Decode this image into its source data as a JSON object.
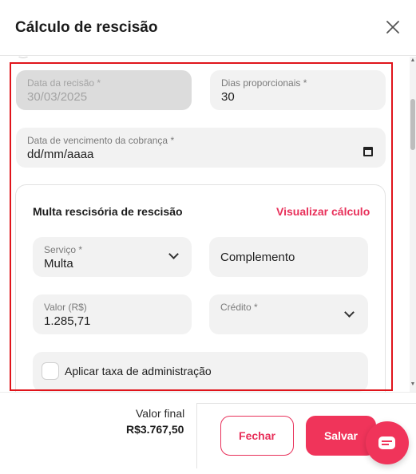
{
  "dialog": {
    "title": "Cálculo de rescisão",
    "close_icon": "close-icon"
  },
  "form": {
    "data_rescisao": {
      "label": "Data da recisão *",
      "value": "30/03/2025",
      "disabled": true
    },
    "dias_proporcionais": {
      "label": "Dias proporcionais *",
      "value": "30"
    },
    "data_vencimento": {
      "label": "Data de vencimento da cobrança *",
      "value": "dd/mm/aaaa",
      "icon": "calendar-icon"
    }
  },
  "multa_card": {
    "title": "Multa rescisória de rescisão",
    "link": "Visualizar cálculo",
    "servico": {
      "label": "Serviço *",
      "value": "Multa"
    },
    "complemento": {
      "placeholder": "Complemento"
    },
    "valor": {
      "label": "Valor (R$)",
      "value": "1.285,71"
    },
    "credito": {
      "label": "Crédito *",
      "value": ""
    },
    "taxa_admin": {
      "label": "Aplicar taxa de administração",
      "checked": false
    }
  },
  "footer": {
    "final_label": "Valor final",
    "final_value": "R$3.767,50",
    "fechar": "Fechar",
    "salvar": "Salvar",
    "chat_icon": "chat-icon"
  },
  "colors": {
    "accent": "#f0345a",
    "highlight": "#e0141b"
  }
}
